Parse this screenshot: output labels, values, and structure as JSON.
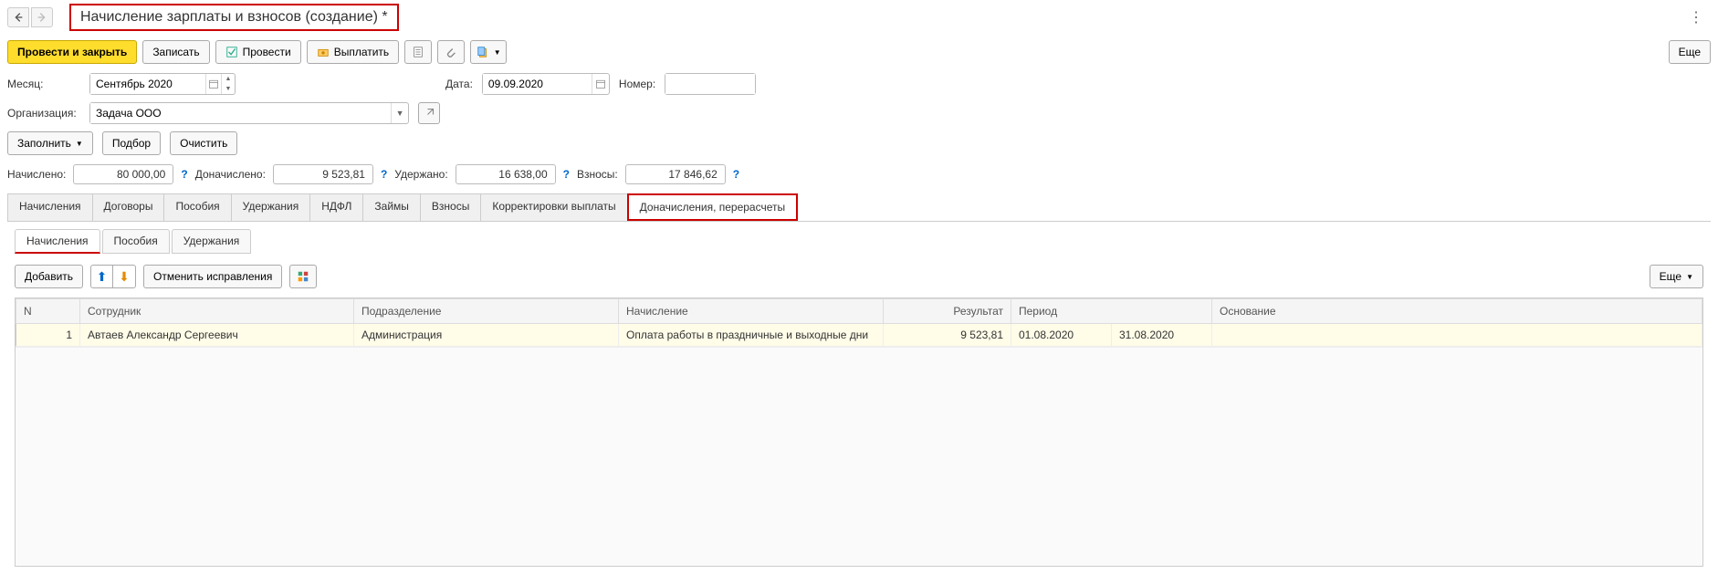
{
  "header": {
    "title": "Начисление зарплаты и взносов (создание) *"
  },
  "toolbar": {
    "post_close": "Провести и закрыть",
    "write": "Записать",
    "post": "Провести",
    "pay": "Выплатить",
    "more": "Еще"
  },
  "form": {
    "month_label": "Месяц:",
    "month_value": "Сентябрь 2020",
    "date_label": "Дата:",
    "date_value": "09.09.2020",
    "number_label": "Номер:",
    "number_value": "",
    "org_label": "Организация:",
    "org_value": "Задача ООО"
  },
  "actions": {
    "fill": "Заполнить",
    "pick": "Подбор",
    "clear": "Очистить"
  },
  "totals": {
    "accrued_label": "Начислено:",
    "accrued": "80 000,00",
    "addl_label": "Доначислено:",
    "addl": "9 523,81",
    "withheld_label": "Удержано:",
    "withheld": "16 638,00",
    "contrib_label": "Взносы:",
    "contrib": "17 846,62"
  },
  "tabs": {
    "main": [
      "Начисления",
      "Договоры",
      "Пособия",
      "Удержания",
      "НДФЛ",
      "Займы",
      "Взносы",
      "Корректировки выплаты",
      "Доначисления, перерасчеты"
    ],
    "sub": [
      "Начисления",
      "Пособия",
      "Удержания"
    ]
  },
  "inner_toolbar": {
    "add": "Добавить",
    "cancel_fix": "Отменить исправления",
    "more": "Еще"
  },
  "table": {
    "headers": {
      "n": "N",
      "employee": "Сотрудник",
      "dept": "Подразделение",
      "accrual": "Начисление",
      "result": "Результат",
      "period": "Период",
      "basis": "Основание"
    },
    "rows": [
      {
        "n": "1",
        "employee": "Автаев Александр Сергеевич",
        "dept": "Администрация",
        "accrual": "Оплата работы в праздничные и выходные дни",
        "result": "9 523,81",
        "period_from": "01.08.2020",
        "period_to": "31.08.2020",
        "basis": ""
      }
    ]
  }
}
